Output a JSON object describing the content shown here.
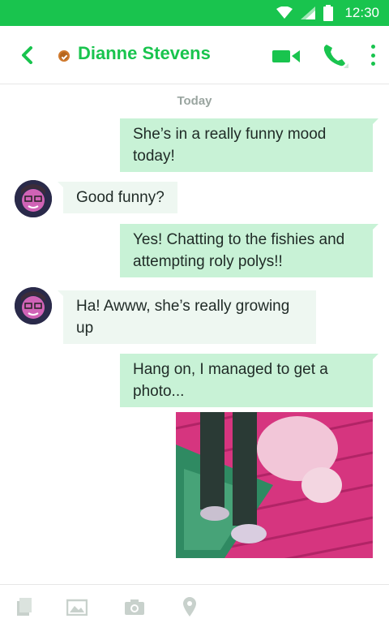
{
  "status_bar": {
    "time": "12:30",
    "icons": [
      "wifi-icon",
      "signal-icon",
      "battery-icon"
    ],
    "color": "#19c44e"
  },
  "header": {
    "contact_name": "Dianne Stevens",
    "presence_status": "away",
    "accent_color": "#19c44e",
    "icons": [
      "back-arrow-icon",
      "video-call-icon",
      "phone-icon",
      "more-vert-icon"
    ]
  },
  "conversation": {
    "day_label": "Today",
    "messages": [
      {
        "direction": "outgoing",
        "text": "She’s in a really funny mood today!"
      },
      {
        "direction": "incoming",
        "text": "Good funny?"
      },
      {
        "direction": "outgoing",
        "text": "Yes! Chatting to the fishies and attempting roly polys!!"
      },
      {
        "direction": "incoming",
        "text": "Ha! Awww, she’s really growing up"
      },
      {
        "direction": "outgoing",
        "text": "Hang on, I managed to get a photo..."
      },
      {
        "direction": "outgoing",
        "type": "photo"
      }
    ]
  },
  "composer": {
    "icons": [
      "file-icon",
      "gallery-icon",
      "camera-icon",
      "location-pin-icon"
    ]
  }
}
